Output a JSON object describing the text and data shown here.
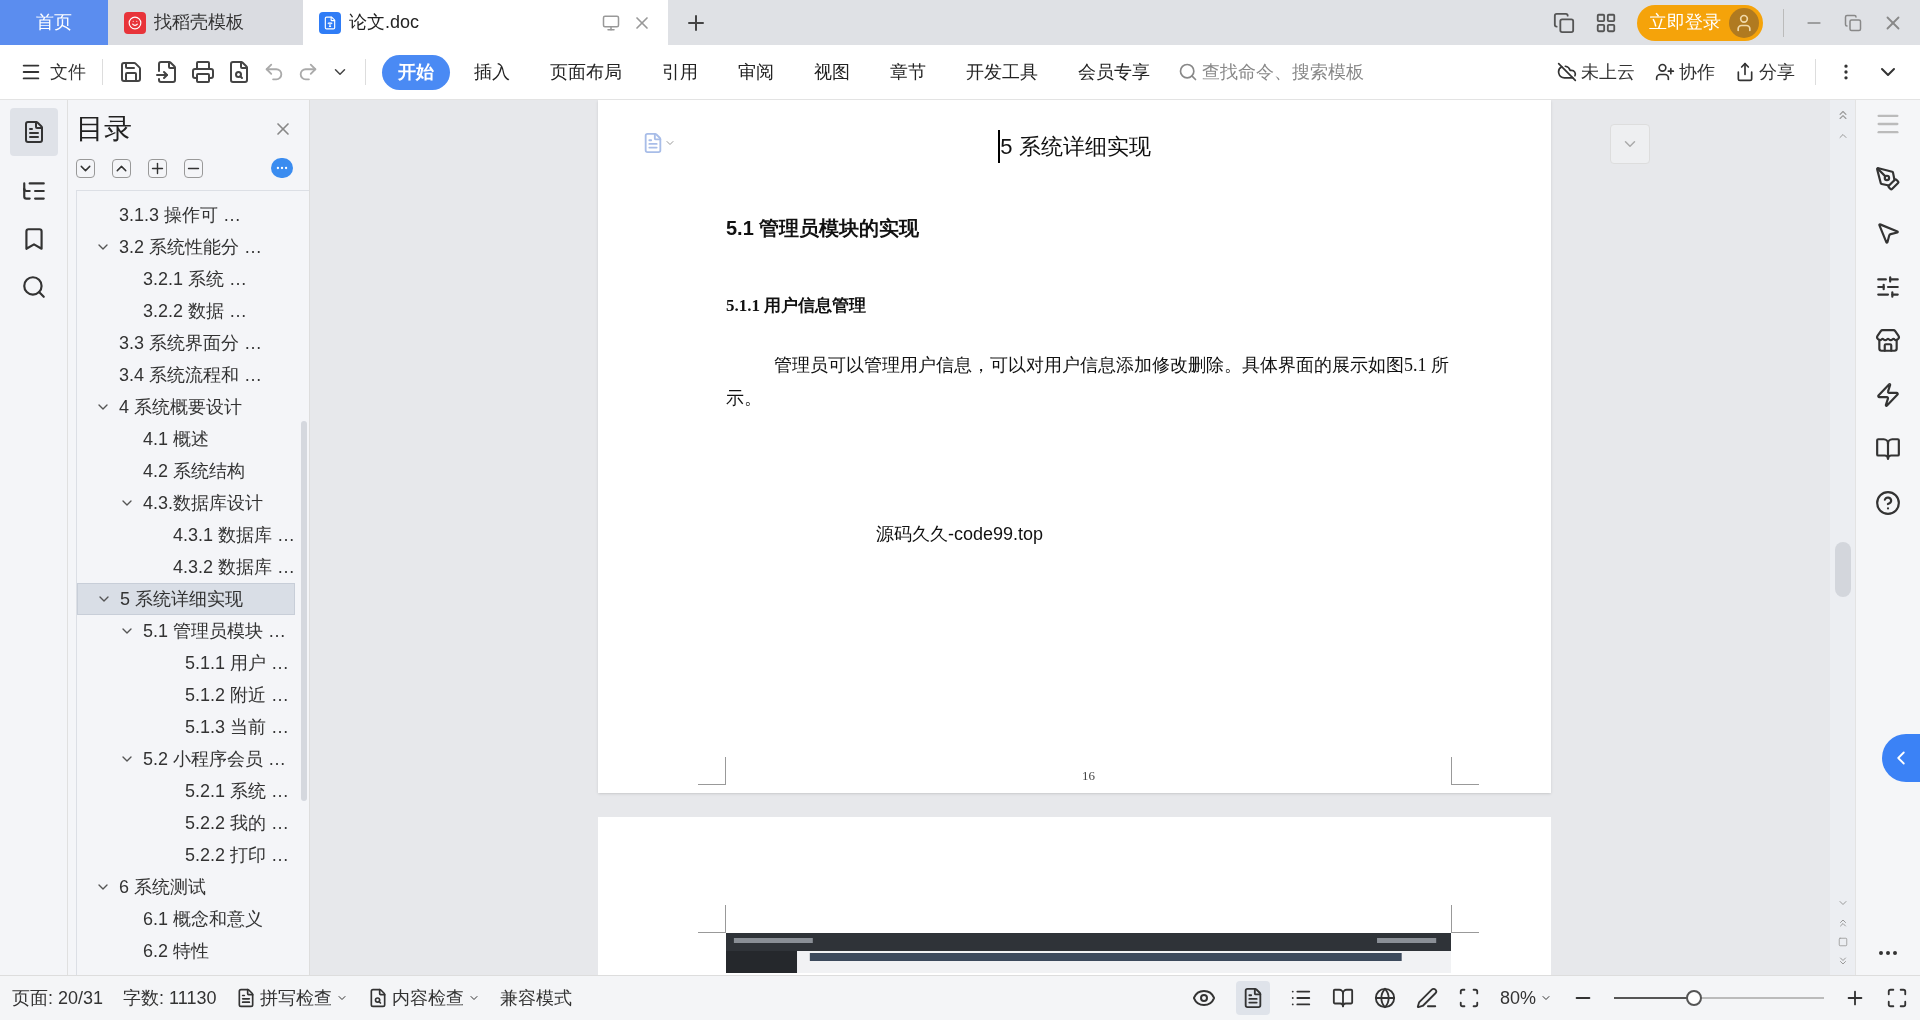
{
  "title_tabs": [
    {
      "label": "首页",
      "kind": "home",
      "selected": false
    },
    {
      "label": "找稻壳模板",
      "kind": "template",
      "selected": false
    },
    {
      "label": "论文.doc",
      "kind": "document",
      "selected": true
    }
  ],
  "login_button": "立即登录",
  "file_menu": "文件",
  "ribbon_tabs": [
    {
      "label": "开始",
      "selected": true
    },
    {
      "label": "插入",
      "selected": false
    },
    {
      "label": "页面布局",
      "selected": false
    },
    {
      "label": "引用",
      "selected": false
    },
    {
      "label": "审阅",
      "selected": false
    },
    {
      "label": "视图",
      "selected": false
    },
    {
      "label": "章节",
      "selected": false
    },
    {
      "label": "开发工具",
      "selected": false
    },
    {
      "label": "会员专享",
      "selected": false
    }
  ],
  "search": {
    "placeholder": "查找命令、搜索模板"
  },
  "right_actions": [
    {
      "label": "未上云",
      "kind": "cloud"
    },
    {
      "label": "协作",
      "kind": "collab"
    },
    {
      "label": "分享",
      "kind": "share"
    }
  ],
  "toc": {
    "title": "目录",
    "items": [
      {
        "children": [
          {
            "children": [
              {
                "label": "3.1.3 操作可 …"
              }
            ]
          },
          {
            "label": "3.2 系统性能分 …",
            "expanded": true,
            "children": [
              {
                "label": "3.2.1  系统 …"
              },
              {
                "label": "3.2.2  数据 …"
              }
            ]
          },
          {
            "label": "3.3 系统界面分 …"
          },
          {
            "label": "3.4 系统流程和 …"
          }
        ]
      },
      {
        "label": "4 系统概要设计",
        "expanded": true,
        "children": [
          {
            "label": "4.1 概述"
          },
          {
            "label": "4.2 系统结构"
          },
          {
            "label": "4.3.数据库设计",
            "expanded": true,
            "children": [
              {
                "label": "4.3.1 数据库 …"
              },
              {
                "label": "4.3.2 数据库 …"
              }
            ]
          }
        ]
      },
      {
        "label": "5 系统详细实现",
        "expanded": true,
        "selected": true,
        "children": [
          {
            "label": "5.1  管理员模块 …",
            "expanded": true,
            "children": [
              {
                "label": "5.1.1  用户 …"
              },
              {
                "label": "5.1.2  附近 …"
              },
              {
                "label": "5.1.3  当前 …"
              }
            ]
          },
          {
            "label": "5.2  小程序会员 …",
            "expanded": true,
            "children": [
              {
                "label": "5.2.1  系统 …"
              },
              {
                "label": "5.2.2  我的 …"
              },
              {
                "label": "5.2.2  打印 …"
              }
            ]
          }
        ]
      },
      {
        "label": "6 系统测试",
        "expanded": true,
        "children": [
          {
            "label": "6.1 概念和意义"
          },
          {
            "label": "6.2 特性"
          }
        ]
      }
    ]
  },
  "document": {
    "chapter_title": "5 系统详细实现",
    "section_title": "5.1  管理员模块的实现",
    "subsection_title": "5.1.1  用户信息管理",
    "paragraph": "管理员可以管理用户信息，可以对用户信息添加修改删除。具体界面的展示如图5.1 所示。",
    "figure_placeholder": "源码久久-code99.top",
    "page_number": "16"
  },
  "status_bar": {
    "page": "页面: 20/31",
    "words": "字数: 11130",
    "spell_check": "拼写检查",
    "content_check": "内容检查",
    "compat_mode": "兼容模式",
    "zoom": "80%",
    "zoom_slider": {
      "level": 0.38
    }
  }
}
